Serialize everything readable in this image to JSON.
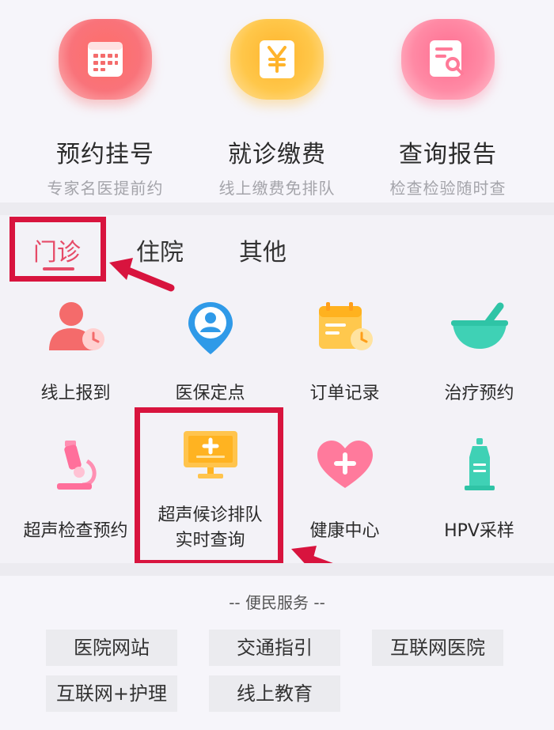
{
  "quick_services": [
    {
      "title": "预约挂号",
      "subtitle": "专家名医提前约",
      "icon": "calendar-icon",
      "color": "#f9737a"
    },
    {
      "title": "就诊缴费",
      "subtitle": "线上缴费免排队",
      "icon": "yuan-icon",
      "color": "#ffc74a"
    },
    {
      "title": "查询报告",
      "subtitle": "检查检验随时查",
      "icon": "report-search-icon",
      "color": "#ff8aa5"
    }
  ],
  "tabs": [
    {
      "label": "门诊",
      "active": true
    },
    {
      "label": "住院",
      "active": false
    },
    {
      "label": "其他",
      "active": false
    }
  ],
  "grid": [
    {
      "label": "线上报到",
      "icon": "user-clock-icon"
    },
    {
      "label": "医保定点",
      "icon": "location-user-icon"
    },
    {
      "label": "订单记录",
      "icon": "calendar-clock-icon"
    },
    {
      "label": "治疗预约",
      "icon": "mortar-icon"
    },
    {
      "label": "超声检查预约",
      "icon": "microscope-icon"
    },
    {
      "label_line1": "超声候诊排队",
      "label_line2": "实时查询",
      "icon": "monitor-medical-icon"
    },
    {
      "label": "健康中心",
      "icon": "heart-plus-icon"
    },
    {
      "label": "HPV采样",
      "icon": "vial-icon"
    }
  ],
  "services": {
    "title": "-- 便民服务 --",
    "items": [
      "医院网站",
      "交通指引",
      "互联网医院",
      "互联网+护理",
      "线上教育"
    ]
  },
  "colors": {
    "accent": "#e64b68",
    "highlight": "#d8143e"
  }
}
